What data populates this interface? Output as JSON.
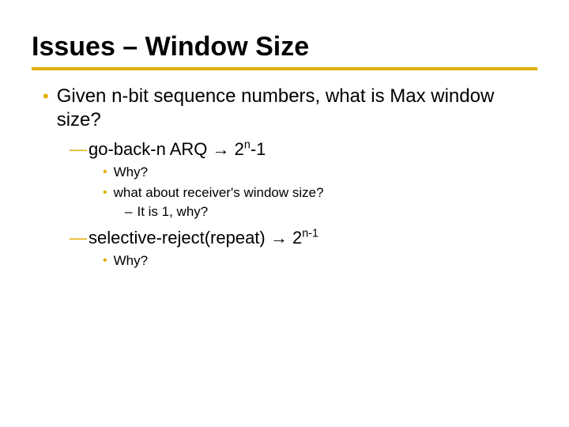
{
  "title": "Issues – Window Size",
  "bullets": {
    "main": "Given n-bit sequence numbers, what is Max window size?",
    "gbn": {
      "name": "go-back-n ARQ",
      "arrow": "→",
      "base": "2",
      "exp": "n",
      "tail": "-1"
    },
    "gbn_sub1": "Why?",
    "gbn_sub2": "what about receiver's window size?",
    "gbn_sub2_sub": "It is 1, why?",
    "sr": {
      "name": "selective-reject(repeat)",
      "arrow": "→",
      "base": "2",
      "exp": "n-1"
    },
    "sr_sub1": "Why?"
  }
}
